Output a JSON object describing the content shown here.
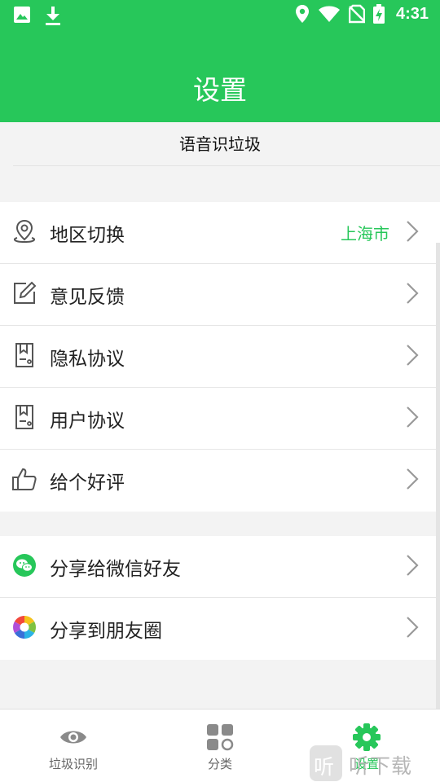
{
  "status_bar": {
    "time": "4:31",
    "icons": [
      "image-icon",
      "download-icon",
      "location-icon",
      "wifi-icon",
      "no-sim-icon",
      "battery-charging-icon"
    ]
  },
  "header": {
    "title": "设置"
  },
  "voice": {
    "label": "语音识垃圾"
  },
  "settings_group": [
    {
      "label": "地区切换",
      "value": "上海市",
      "icon": "location-pin-icon"
    },
    {
      "label": "意见反馈",
      "icon": "edit-icon"
    },
    {
      "label": "隐私协议",
      "icon": "document-icon"
    },
    {
      "label": "用户协议",
      "icon": "document-icon"
    },
    {
      "label": "给个好评",
      "icon": "thumbs-up-icon"
    }
  ],
  "share_group": [
    {
      "label": "分享给微信好友",
      "icon": "wechat-icon"
    },
    {
      "label": "分享到朋友圈",
      "icon": "moments-icon"
    }
  ],
  "tabs": [
    {
      "label": "垃圾识别",
      "icon": "eye-icon",
      "active": false
    },
    {
      "label": "分类",
      "icon": "grid-icon",
      "active": false
    },
    {
      "label": "设置",
      "icon": "gear-icon",
      "active": true
    }
  ],
  "watermark": {
    "glyph": "听",
    "text": "听下载"
  },
  "colors": {
    "brand_green": "#27c75a",
    "background": "#f3f3f3",
    "tab_inactive": "#666666"
  }
}
